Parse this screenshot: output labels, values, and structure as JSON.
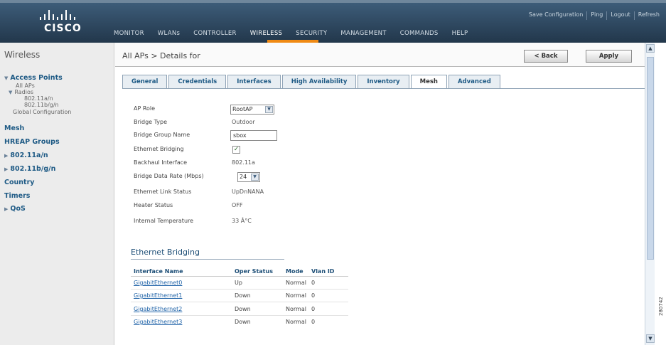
{
  "brand": {
    "logo_text": "CISCO",
    "accent": "#f08a14",
    "header_bg": "#2e4760"
  },
  "top_links": [
    "Save Configuration",
    "Ping",
    "Logout",
    "Refresh"
  ],
  "main_nav": [
    "MONITOR",
    "WLANs",
    "CONTROLLER",
    "WIRELESS",
    "SECURITY",
    "MANAGEMENT",
    "COMMANDS",
    "HELP"
  ],
  "main_nav_active": "WIRELESS",
  "sidebar": {
    "title": "Wireless",
    "items": [
      {
        "label": "Access Points",
        "type": "header",
        "icon": "expanded-arrow-icon"
      },
      {
        "label": "All APs",
        "type": "sub"
      },
      {
        "label": "Radios",
        "type": "sub",
        "icon": "expanded-arrow-icon"
      },
      {
        "label": "802.11a/n",
        "type": "sub"
      },
      {
        "label": "802.11b/g/n",
        "type": "sub"
      },
      {
        "label": "Global Configuration",
        "type": "sub"
      },
      {
        "label": "Mesh",
        "type": "header"
      },
      {
        "label": "HREAP Groups",
        "type": "header"
      },
      {
        "label": "802.11a/n",
        "type": "header",
        "icon": "collapsed-arrow-icon"
      },
      {
        "label": "802.11b/g/n",
        "type": "header",
        "icon": "collapsed-arrow-icon"
      },
      {
        "label": "Country",
        "type": "header"
      },
      {
        "label": "Timers",
        "type": "header"
      },
      {
        "label": "QoS",
        "type": "header",
        "icon": "collapsed-arrow-icon"
      }
    ]
  },
  "breadcrumb": "All APs > Details for",
  "buttons": {
    "back": "< Back",
    "apply": "Apply"
  },
  "tabs": [
    "General",
    "Credentials",
    "Interfaces",
    "High Availability",
    "Inventory",
    "Mesh",
    "Advanced"
  ],
  "active_tab": "Mesh",
  "form": {
    "ap_role": {
      "label": "AP Role",
      "value": "RootAP"
    },
    "bridge_type": {
      "label": "Bridge Type",
      "value": "Outdoor"
    },
    "bridge_group_name": {
      "label": "Bridge Group Name",
      "value": "sbox"
    },
    "ethernet_bridging": {
      "label": "Ethernet Bridging",
      "checked": true
    },
    "backhaul_interface": {
      "label": "Backhaul Interface",
      "value": "802.11a"
    },
    "bridge_data_rate": {
      "label": "Bridge Data Rate (Mbps)",
      "value": "24"
    },
    "ethernet_link_status": {
      "label": "Ethernet Link Status",
      "value": "UpDnNANA"
    },
    "heater_status": {
      "label": "Heater Status",
      "value": "OFF"
    },
    "internal_temperature": {
      "label": "Internal Temperature",
      "value": "33 Â°C"
    }
  },
  "ethernet_bridging_section": {
    "title": "Ethernet Bridging",
    "columns": [
      "Interface Name",
      "Oper Status",
      "Mode",
      "Vlan ID"
    ],
    "rows": [
      [
        "GigabitEthernet0",
        "Up",
        "Normal",
        "0"
      ],
      [
        "GigabitEthernet1",
        "Down",
        "Normal",
        "0"
      ],
      [
        "GigabitEthernet2",
        "Down",
        "Normal",
        "0"
      ],
      [
        "GigabitEthernet3",
        "Down",
        "Normal",
        "0"
      ]
    ]
  },
  "figure_id": "280742"
}
